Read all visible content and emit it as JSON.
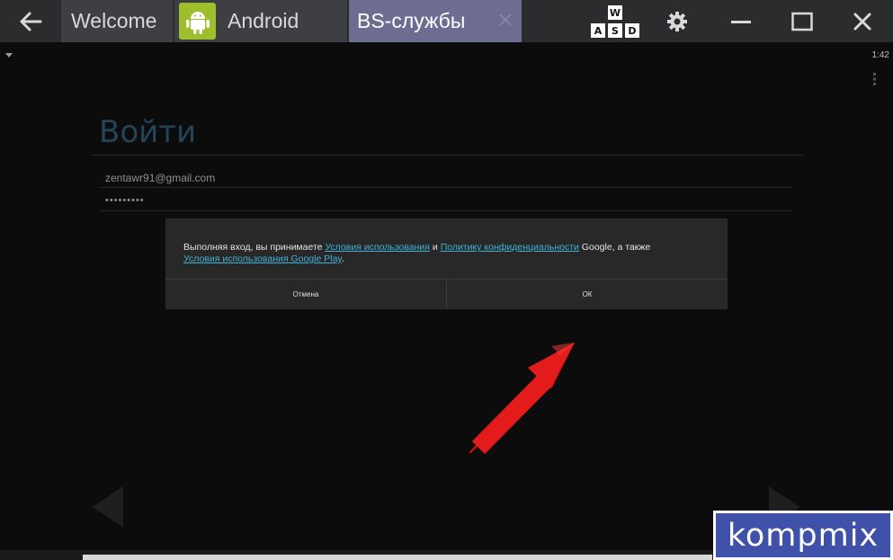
{
  "titlebar": {
    "tabs": [
      {
        "label": "Welcome"
      },
      {
        "label": "Android"
      },
      {
        "label": "BS-службы"
      }
    ],
    "keys": [
      "W",
      "A",
      "S",
      "D"
    ]
  },
  "status": {
    "time": "1:42"
  },
  "signin": {
    "title": "Войти",
    "email": "zentawr91@gmail.com",
    "password": "•••••••••"
  },
  "dialog": {
    "text_before": "Выполняя вход, вы принимаете ",
    "link_terms": "Условия использования",
    "text_and": " и ",
    "link_privacy": "Политику конфиденциальности",
    "text_after": " Google, а также ",
    "link_play": "Условия использования Google Play",
    "text_end": ".",
    "cancel_label": "Отмена",
    "ok_label": "ОК"
  },
  "watermark": {
    "text": "kompmix"
  },
  "colors": {
    "titlebar_bg": "#2b2c2e",
    "active_tab": "#6c6d91",
    "android_green": "#9cbf2b",
    "link": "#3fb2d8",
    "arrow_red": "#e31b1b",
    "watermark_bg": "#3f51a8"
  }
}
